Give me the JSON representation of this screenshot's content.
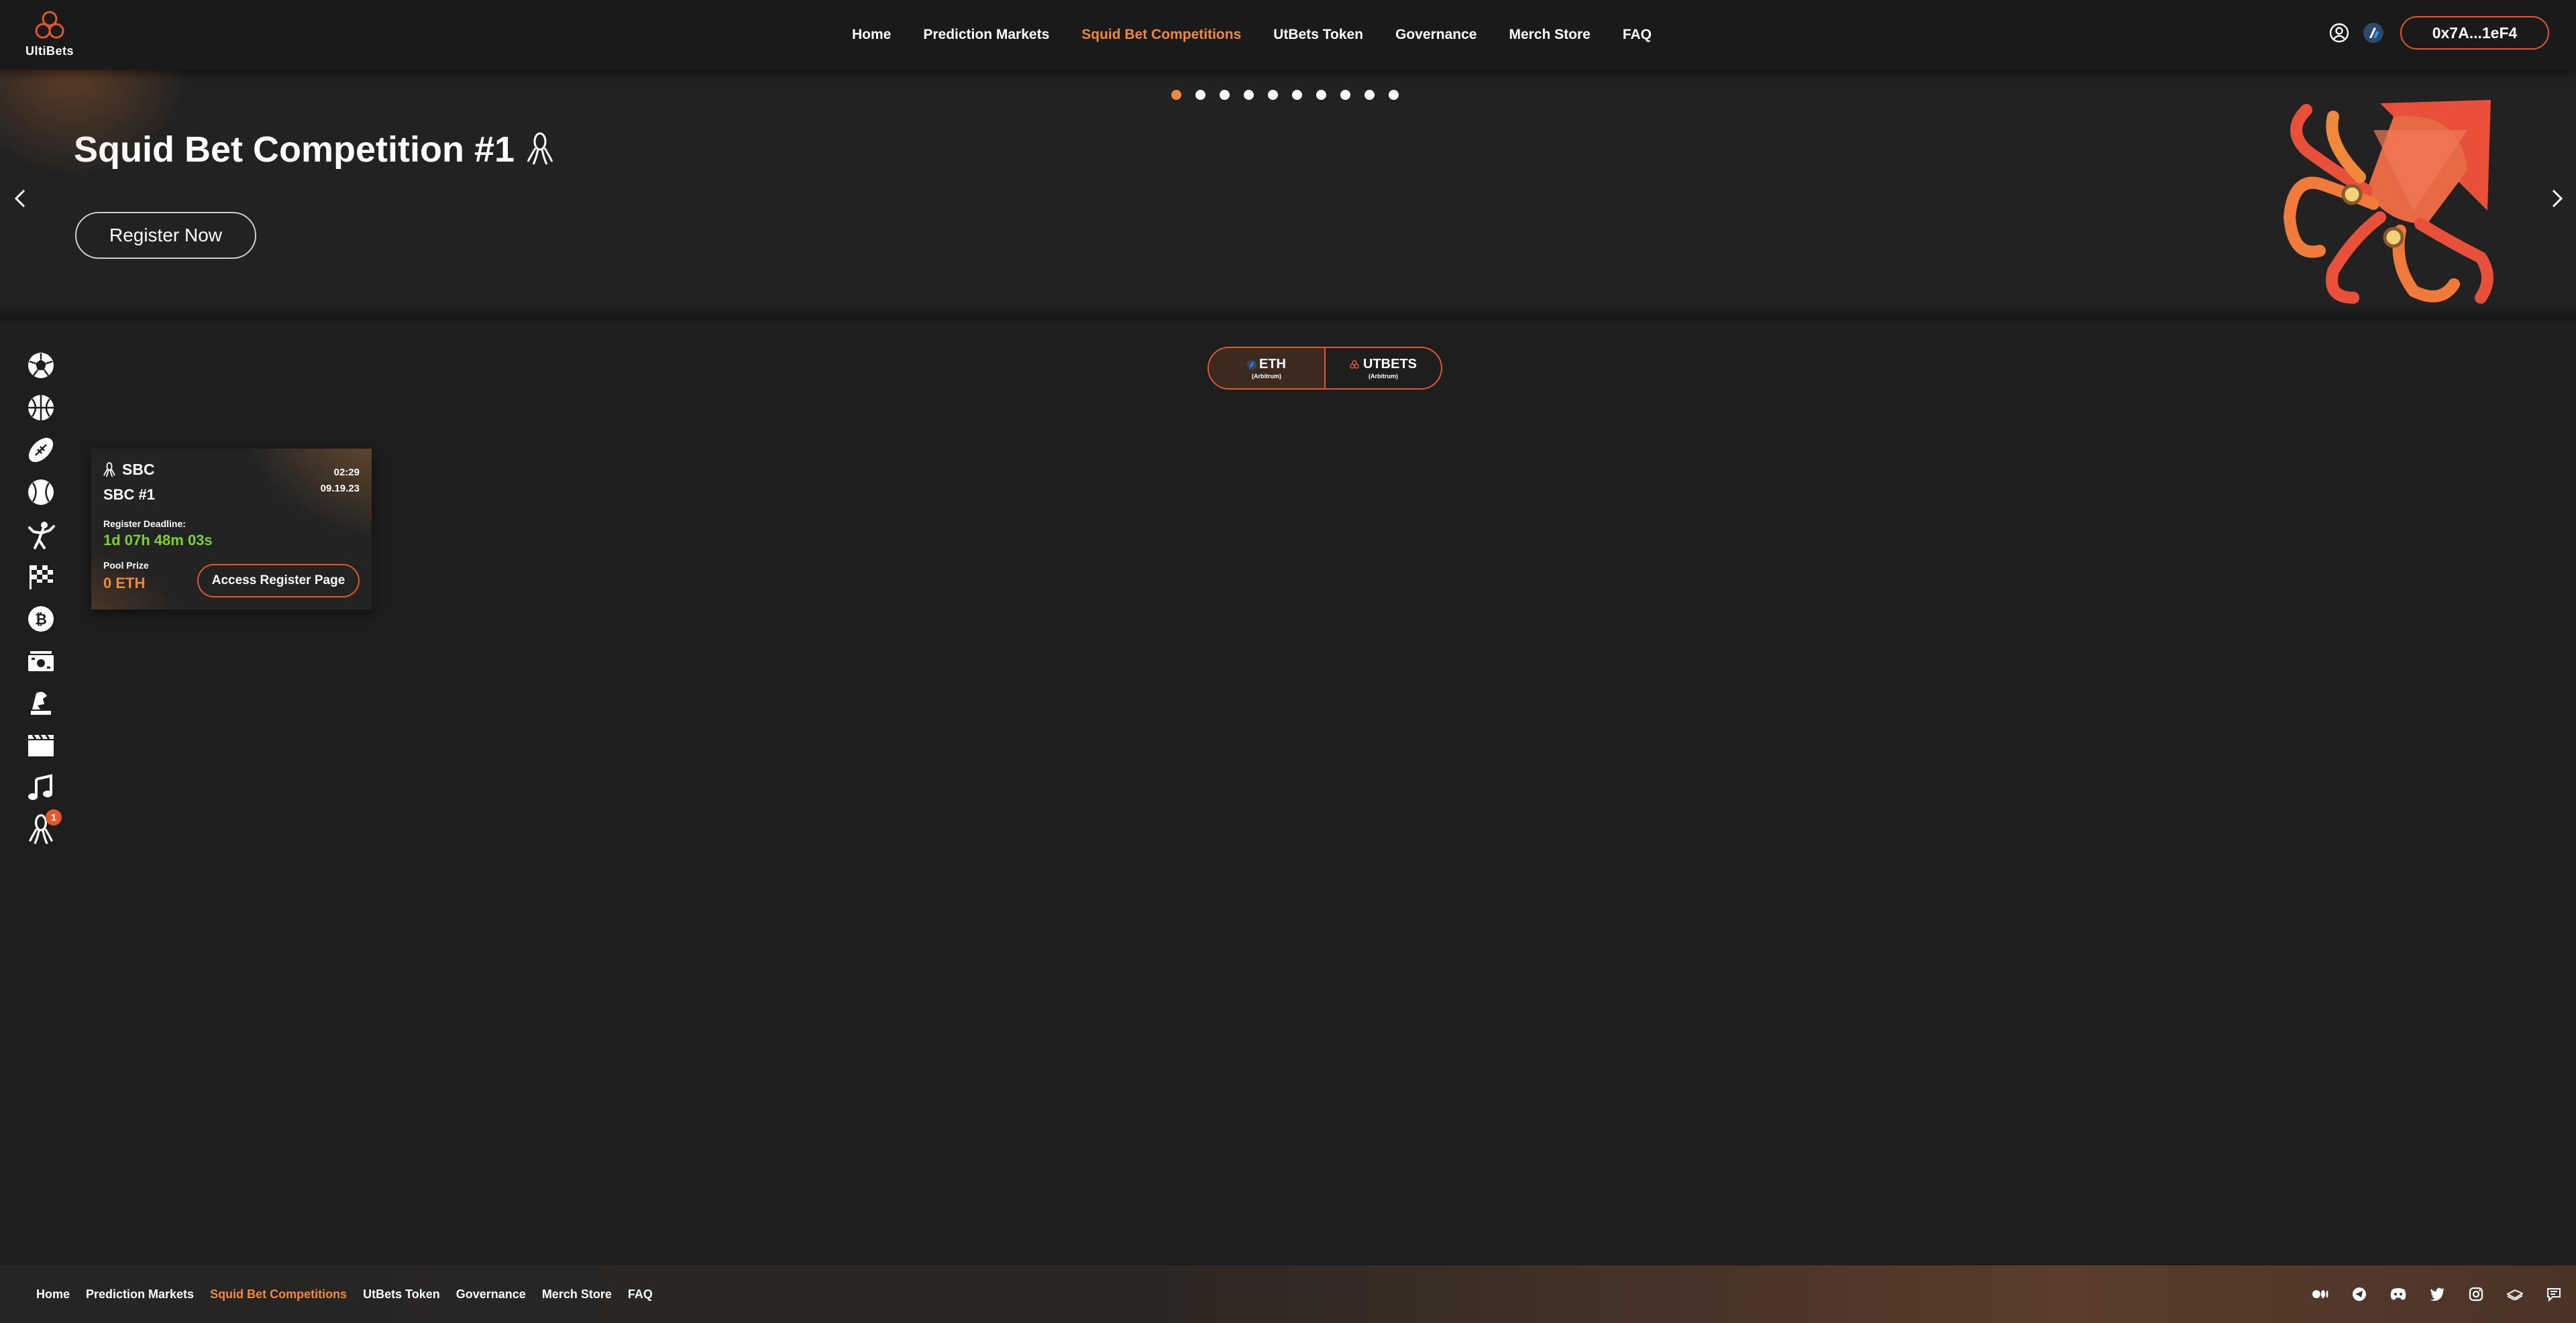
{
  "brand": {
    "name": "UltiBets"
  },
  "nav": {
    "items": [
      {
        "label": "Home",
        "active": false
      },
      {
        "label": "Prediction Markets",
        "active": false
      },
      {
        "label": "Squid Bet Competitions",
        "active": true
      },
      {
        "label": "UtBets Token",
        "active": false
      },
      {
        "label": "Governance",
        "active": false
      },
      {
        "label": "Merch Store",
        "active": false
      },
      {
        "label": "FAQ",
        "active": false
      }
    ]
  },
  "header": {
    "wallet_label": "0x7A...1eF4",
    "icons": [
      "user-icon",
      "arbitrum-icon"
    ]
  },
  "hero": {
    "title": "Squid Bet Competition #1",
    "button_label": "Register Now",
    "slide_count": 10,
    "active_slide": 1
  },
  "sidebar": {
    "icons": [
      "soccer-icon",
      "basketball-icon",
      "football-icon",
      "baseball-icon",
      "boxing-icon",
      "racing-flag-icon",
      "bitcoin-icon",
      "money-icon",
      "politics-icon",
      "movie-icon",
      "music-icon",
      "squid-icon"
    ],
    "badge_count": "1"
  },
  "currency_toggle": {
    "options": [
      {
        "label": "ETH",
        "sub": "(Arbitrum)",
        "active": true
      },
      {
        "label": "UTBETS",
        "sub": "(Arbitrum)",
        "active": false
      }
    ]
  },
  "card": {
    "tag": "SBC",
    "time": "02:29",
    "date": "09.19.23",
    "name": "SBC #1",
    "deadline_label": "Register Deadline:",
    "deadline_value": "1d 07h 48m 03s",
    "pool_label": "Pool Prize",
    "pool_value": "0 ETH",
    "button_label": "Access Register Page"
  },
  "footer": {
    "items": [
      {
        "label": "Home",
        "active": false
      },
      {
        "label": "Prediction Markets",
        "active": false
      },
      {
        "label": "Squid Bet Competitions",
        "active": true
      },
      {
        "label": "UtBets Token",
        "active": false
      },
      {
        "label": "Governance",
        "active": false
      },
      {
        "label": "Merch Store",
        "active": false
      },
      {
        "label": "FAQ",
        "active": false
      }
    ],
    "socials": [
      "medium-icon",
      "telegram-icon",
      "discord-icon",
      "twitter-icon",
      "instagram-icon",
      "gitbook-icon",
      "forum-icon"
    ]
  },
  "colors": {
    "accent": "#f08a3a",
    "border_accent": "#e2582a",
    "timer": "#7cd32a",
    "background": "#1e1e1e"
  }
}
